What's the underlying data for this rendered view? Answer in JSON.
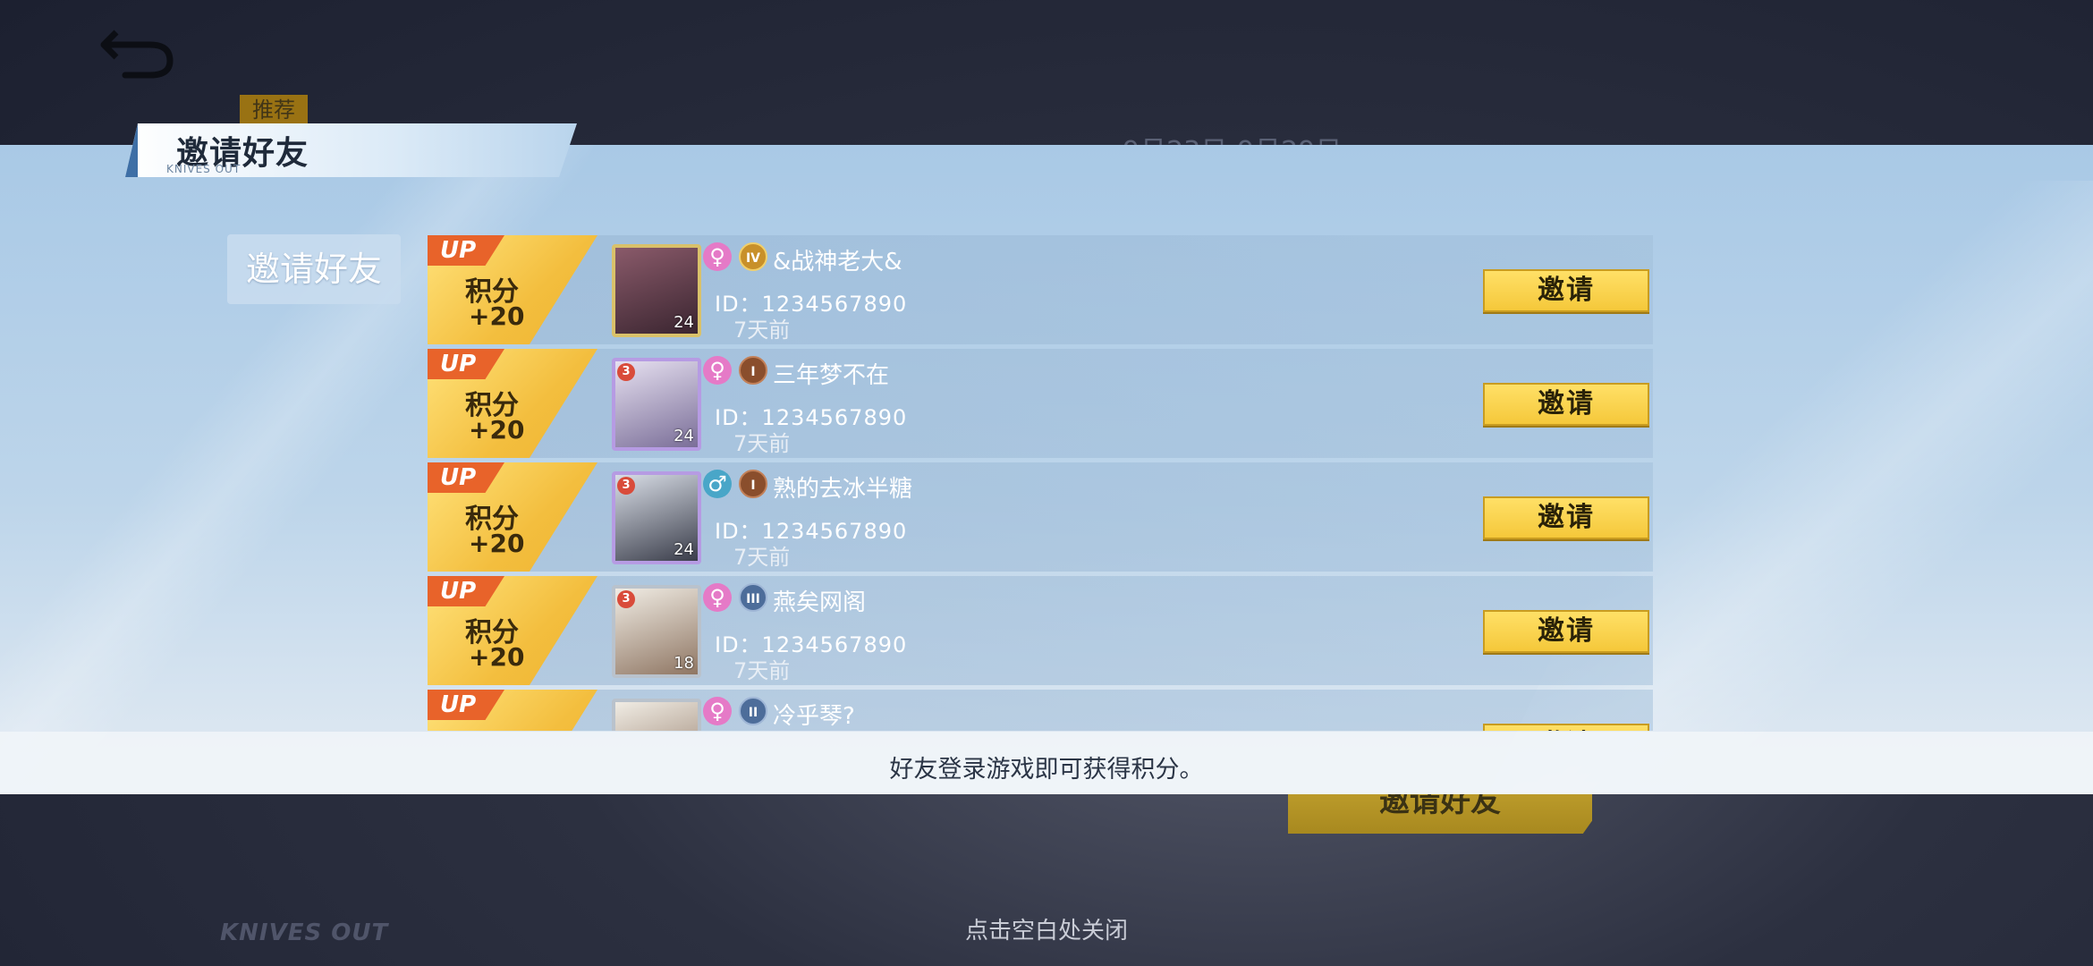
{
  "background": {
    "tag": "推荐",
    "date": "9月23日-9月29日",
    "invite_button": "邀请好友",
    "logo": "KNIVES OUT"
  },
  "header": {
    "title": "邀请好友",
    "subtitle": "KNIVES OUT"
  },
  "side_tab": "邀请好友",
  "badge": {
    "up": "UP",
    "line1": "积分",
    "line2": "+20"
  },
  "friends": [
    {
      "name": "&战神老大&",
      "gender": "female",
      "tier": "IV",
      "id": "ID：1234567890",
      "time": "7天前",
      "level": "24",
      "invite": "邀请"
    },
    {
      "name": "三年梦不在",
      "gender": "female",
      "tier": "I",
      "id": "ID：1234567890",
      "time": "7天前",
      "level": "24",
      "rank": "3",
      "invite": "邀请"
    },
    {
      "name": "熟的去冰半糖",
      "gender": "male",
      "tier": "I",
      "id": "ID：1234567890",
      "time": "7天前",
      "level": "24",
      "rank": "3",
      "invite": "邀请"
    },
    {
      "name": "燕矣网阁",
      "gender": "female",
      "tier": "III",
      "id": "ID：1234567890",
      "time": "7天前",
      "level": "18",
      "rank": "3",
      "invite": "邀请"
    },
    {
      "name": "冷乎琴?",
      "gender": "female",
      "tier": "II",
      "id": "",
      "time": "",
      "level": "",
      "invite": "邀请"
    }
  ],
  "footer": "好友登录游戏即可获得积分。",
  "close_hint": "点击空白处关闭",
  "icons": {
    "back": "back-arrow-icon",
    "female": "♀",
    "male": "♂"
  }
}
